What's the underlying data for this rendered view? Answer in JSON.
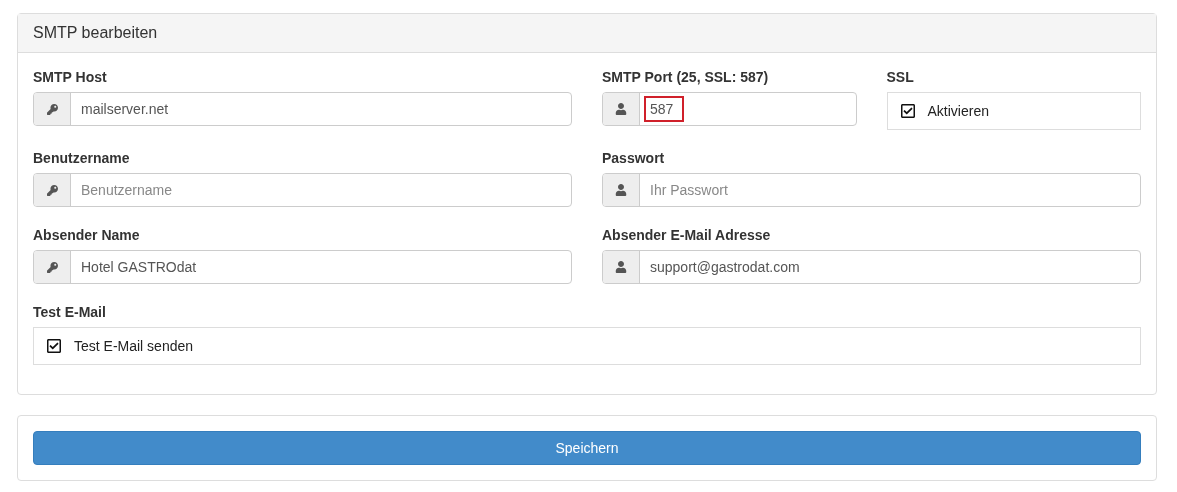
{
  "panel": {
    "title": "SMTP bearbeiten"
  },
  "fields": [
    {
      "kind": "key_input",
      "label": "SMTP Host",
      "value": "mailserver.net",
      "highlighted": false
    },
    {
      "kind": "user_input",
      "label": "SMTP Port (25, SSL: 587)",
      "value": "587",
      "highlighted": true
    },
    {
      "kind": "checkbox",
      "label": "SSL",
      "text": "Aktivieren",
      "checked": true
    },
    {
      "kind": "key_input",
      "label": "Benutzername",
      "placeholder": "Benutzername",
      "highlighted": false
    },
    {
      "kind": "user_input",
      "label": "Passwort",
      "placeholder": "Ihr Passwort",
      "highlighted": false
    },
    {
      "kind": "key_input",
      "label": "Absender Name",
      "value": "Hotel GASTROdat",
      "highlighted": false
    },
    {
      "kind": "user_input",
      "label": "Absender E-Mail Adresse",
      "value": "support@gastrodat.com",
      "highlighted": false
    },
    {
      "kind": "checkbox",
      "label": "Test E-Mail",
      "text": "Test E-Mail senden",
      "checked": true
    }
  ],
  "save_button": "Speichern"
}
